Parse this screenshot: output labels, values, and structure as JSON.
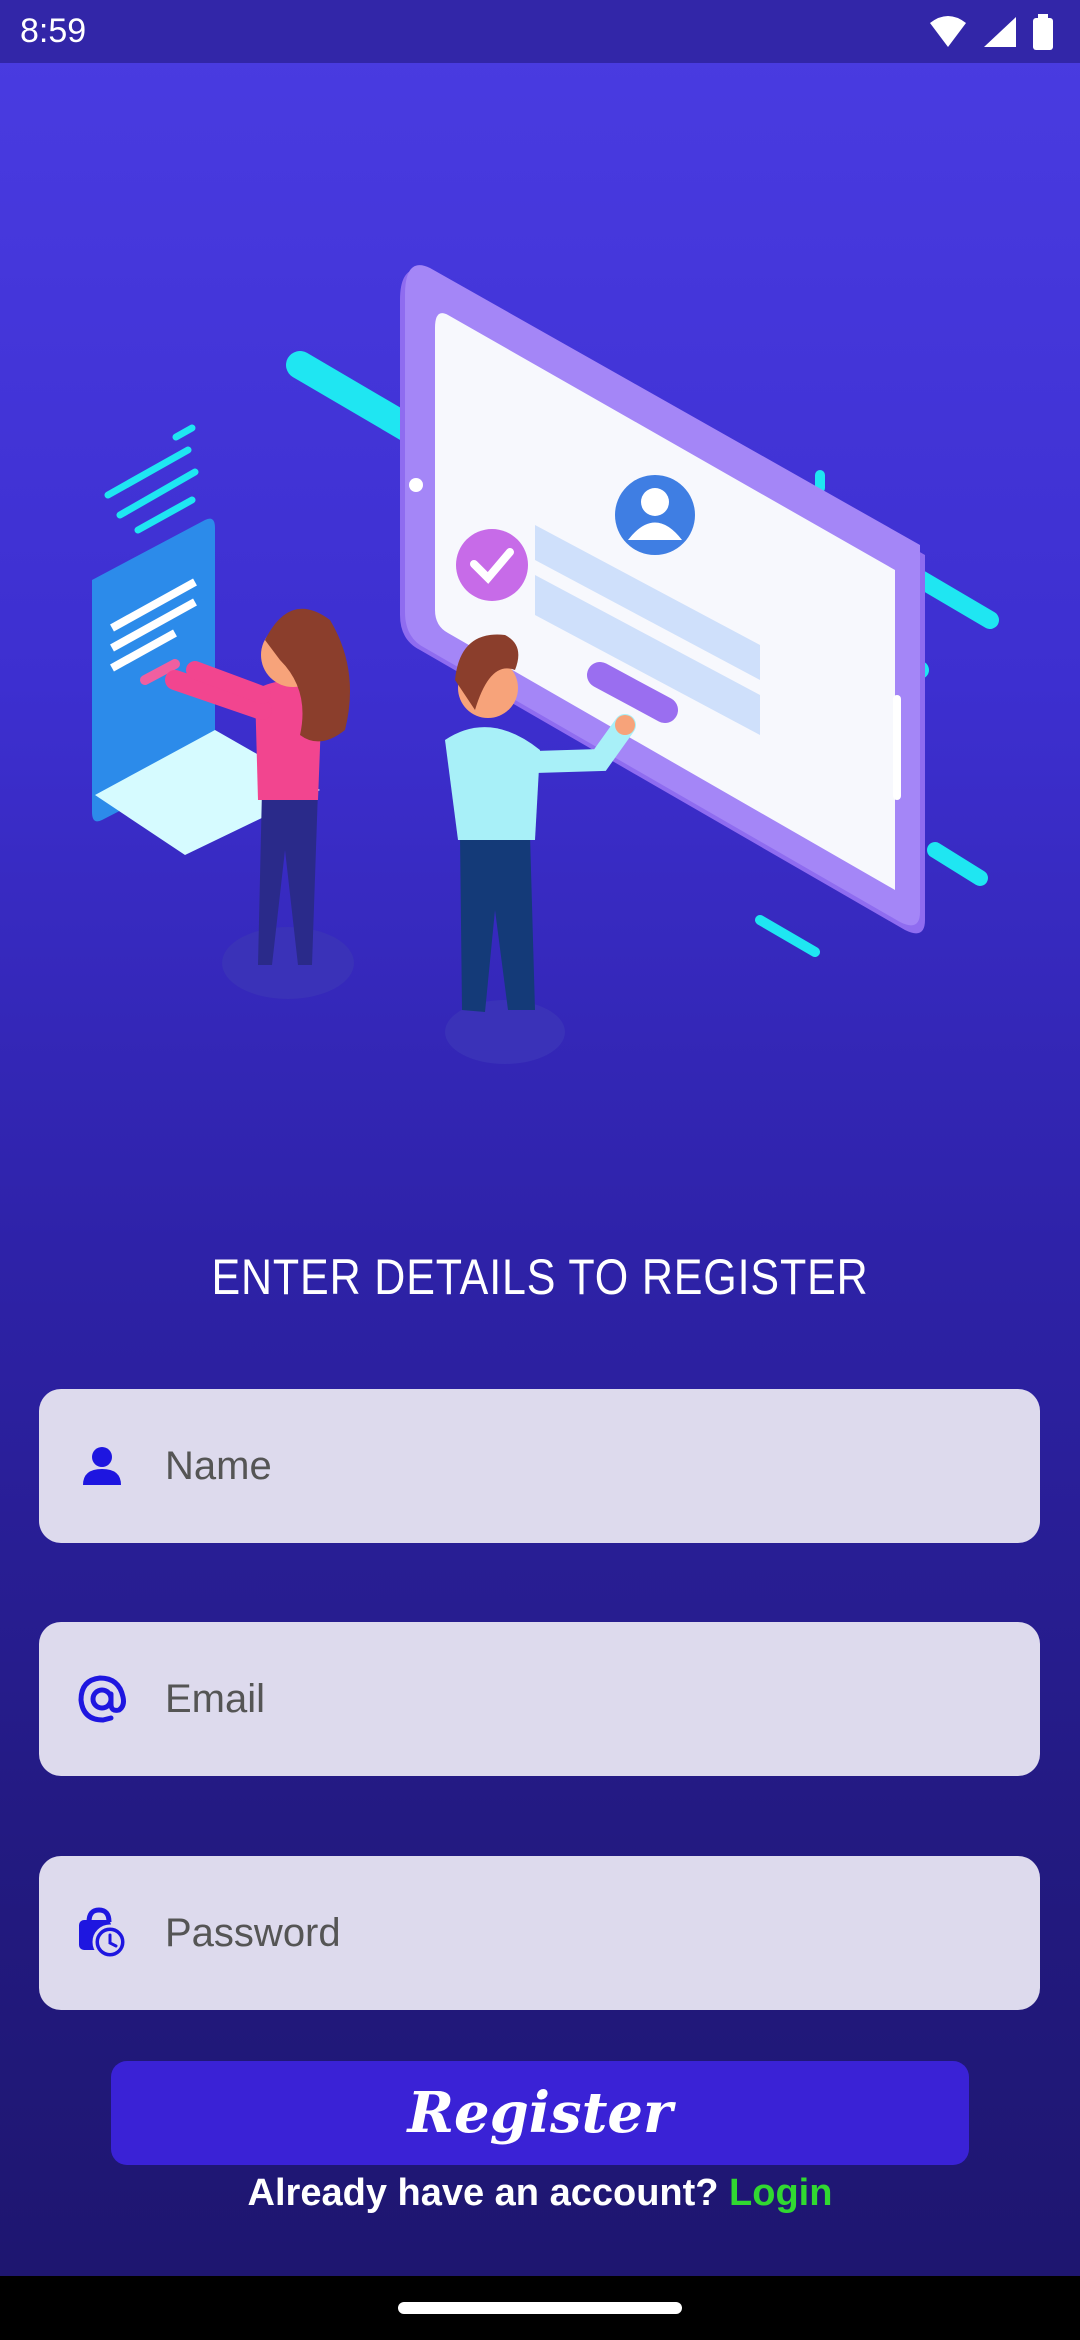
{
  "status_bar": {
    "time": "8:59",
    "icons": [
      "wifi-icon",
      "signal-icon",
      "battery-icon"
    ]
  },
  "heading": "ENTER DETAILS TO REGISTER",
  "fields": {
    "name": {
      "placeholder": "Name",
      "icon": "person-icon"
    },
    "email": {
      "placeholder": "Email",
      "icon": "at-sign-icon"
    },
    "password": {
      "placeholder": "Password",
      "icon": "lock-clock-icon"
    }
  },
  "register_button": "Register",
  "login_prompt": {
    "text": "Already have an account? ",
    "link": "Login"
  },
  "colors": {
    "accent": "#3a22d6",
    "link": "#31d831",
    "field_bg": "#dddaed"
  }
}
